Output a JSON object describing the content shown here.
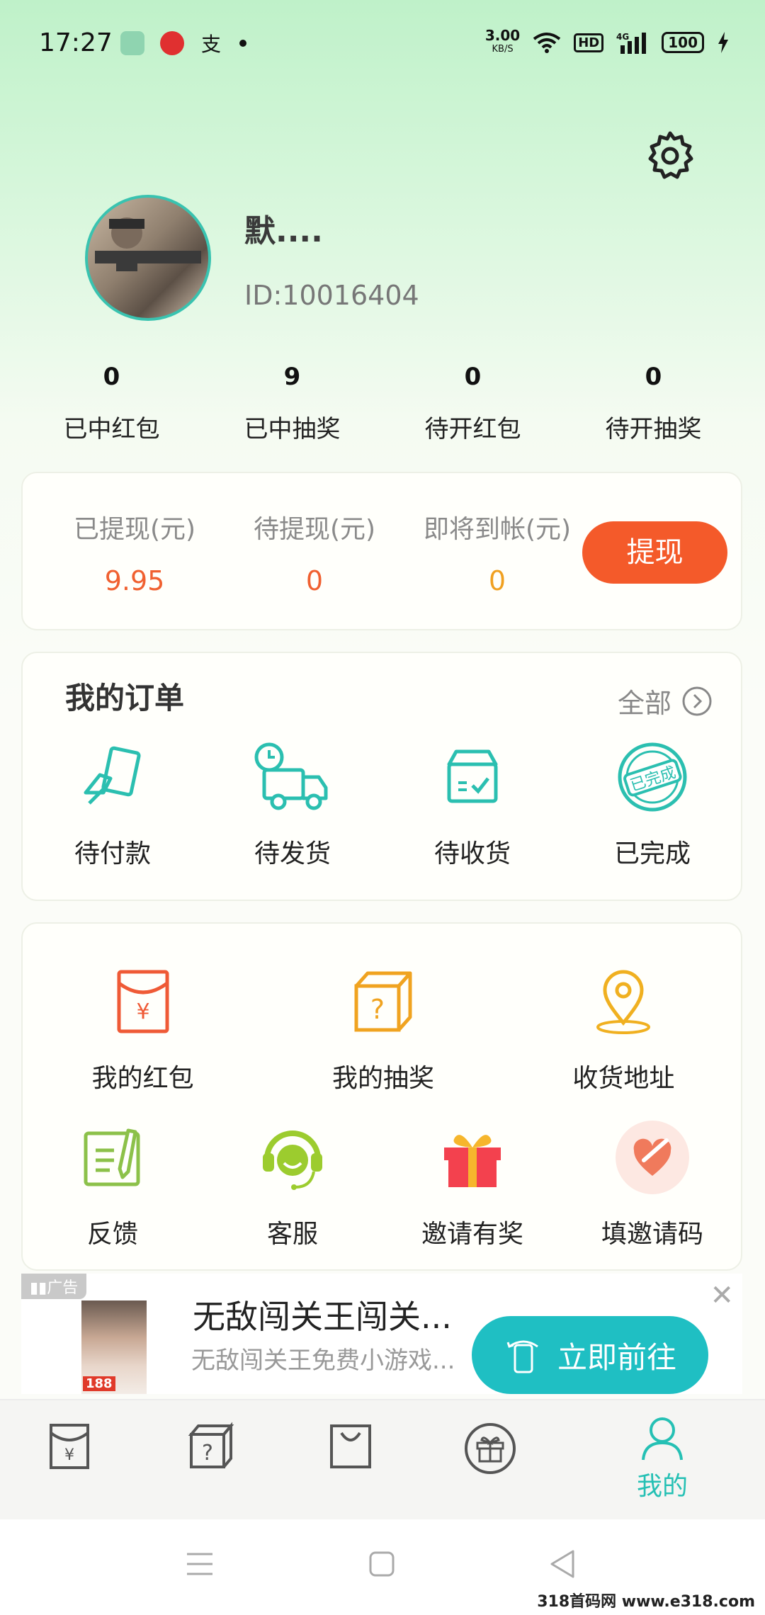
{
  "status_bar": {
    "time": "17:27",
    "net_speed": "3.00",
    "net_unit": "KB/S",
    "hd": "HD",
    "signal": "4G",
    "battery": "100"
  },
  "profile": {
    "name": "默....",
    "id": "ID:10016404"
  },
  "stats": [
    {
      "value": "0",
      "label": "已中红包"
    },
    {
      "value": "9",
      "label": "已中抽奖"
    },
    {
      "value": "0",
      "label": "待开红包"
    },
    {
      "value": "0",
      "label": "待开抽奖"
    }
  ],
  "money": {
    "withdrawn_label": "已提现(元)",
    "withdrawn_value": "9.95",
    "pending_label": "待提现(元)",
    "pending_value": "0",
    "incoming_label": "即将到帐(元)",
    "incoming_value": "0",
    "withdraw_button": "提现"
  },
  "orders": {
    "title": "我的订单",
    "all": "全部",
    "items": [
      {
        "label": "待付款",
        "icon": "payment-icon"
      },
      {
        "label": "待发货",
        "icon": "truck-icon"
      },
      {
        "label": "待收货",
        "icon": "box-icon"
      },
      {
        "label": "已完成",
        "icon": "completed-stamp-icon"
      }
    ]
  },
  "tools": {
    "row1": [
      {
        "label": "我的红包",
        "icon": "red-packet-icon"
      },
      {
        "label": "我的抽奖",
        "icon": "mystery-box-icon"
      },
      {
        "label": "收货地址",
        "icon": "location-pin-icon"
      }
    ],
    "row2": [
      {
        "label": "反馈",
        "icon": "feedback-icon"
      },
      {
        "label": "客服",
        "icon": "customer-service-icon"
      },
      {
        "label": "邀请有奖",
        "icon": "gift-icon"
      },
      {
        "label": "填邀请码",
        "icon": "invite-code-icon"
      }
    ]
  },
  "ad": {
    "tag": "广告",
    "title": "无敌闯关王闯关...",
    "desc": "无敌闯关王免费小游戏...",
    "button": "立即前往",
    "badge": "188"
  },
  "bottom_nav": {
    "active_label": "我的"
  },
  "watermark": "318首码网 www.e318.com",
  "colors": {
    "accent": "#25c0b4",
    "withdraw": "#f45a2a",
    "money_red": "#f06030",
    "money_orange": "#f0a020"
  }
}
